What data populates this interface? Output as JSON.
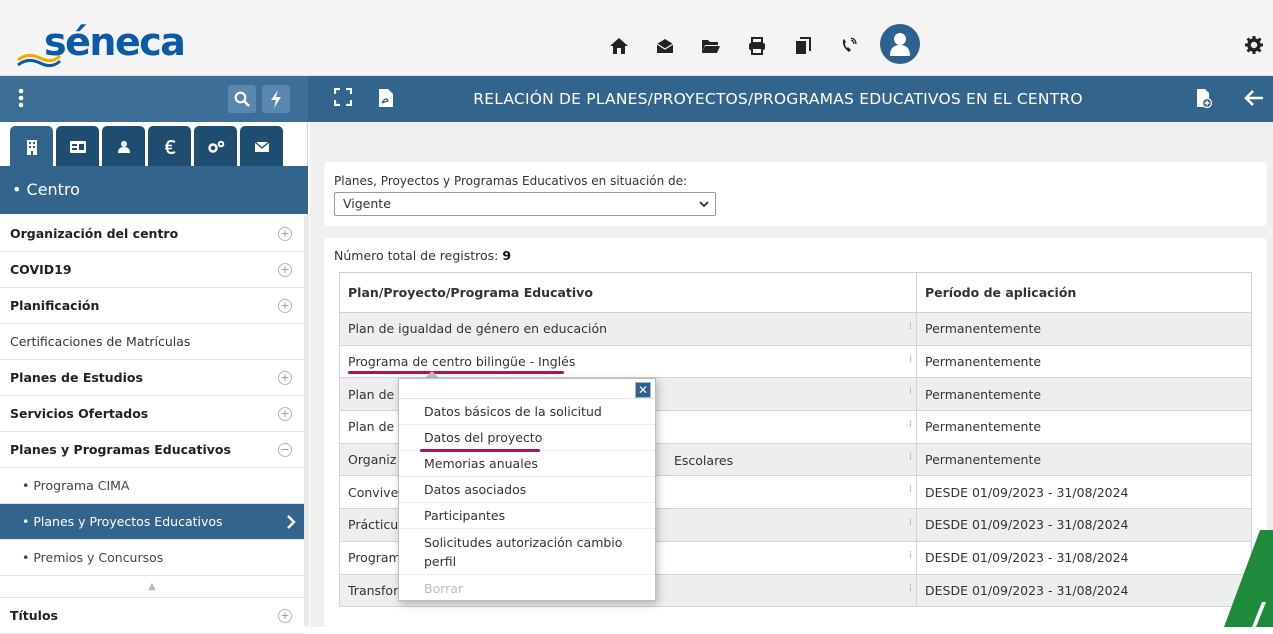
{
  "app": {
    "logo_text": "séneca"
  },
  "topbar": {
    "icons": [
      "home-icon",
      "inbox-icon",
      "folder-icon",
      "print-icon",
      "copy-icon",
      "phone-icon",
      "user-avatar-icon"
    ],
    "settings_icon": "gear-icon"
  },
  "titlebar": {
    "title": "RELACIÓN DE PLANES/PROYECTOS/PROGRAMAS EDUCATIVOS EN EL CENTRO"
  },
  "sidebar": {
    "tabs": [
      "building-icon",
      "id-card-icon",
      "people-icon",
      "euro-icon",
      "gears-icon",
      "mail-icon"
    ],
    "section_title": "• Centro",
    "items": [
      {
        "label": "Organización del centro",
        "expand": "+"
      },
      {
        "label": "COVID19",
        "expand": "+"
      },
      {
        "label": "Planificación",
        "expand": "+"
      },
      {
        "label": "Certificaciones de Matrículas"
      },
      {
        "label": "Planes de Estudios",
        "expand": "+"
      },
      {
        "label": "Servicios Ofertados",
        "expand": "+"
      },
      {
        "label": "Planes y Programas Educativos",
        "expand": "−"
      },
      {
        "label": "• Programa CIMA"
      },
      {
        "label": "• Planes y Proyectos Educativos"
      },
      {
        "label": "• Premios y Concursos"
      },
      {
        "label": "Títulos",
        "expand": "+"
      }
    ]
  },
  "filter": {
    "label": "Planes, Proyectos y Programas Educativos en situación de:",
    "selected": "Vigente"
  },
  "records": {
    "label": "Número total de registros:",
    "count": "9"
  },
  "table": {
    "headers": [
      "Plan/Proyecto/Programa Educativo",
      "Período de aplicación"
    ],
    "rows": [
      [
        "Plan de igualdad de género en educación",
        "Permanentemente"
      ],
      [
        "Programa de centro bilingüe - Inglés",
        "Permanentemente"
      ],
      [
        "Plan de",
        "Permanentemente"
      ],
      [
        "Plan de",
        "Permanentemente"
      ],
      [
        "Organiz",
        "Permanentemente"
      ],
      [
        "Convive",
        "DESDE 01/09/2023 - 31/08/2024"
      ],
      [
        "Prácticu",
        "DESDE 01/09/2023 - 31/08/2024"
      ],
      [
        "Program",
        "DESDE 01/09/2023 - 31/08/2024"
      ],
      [
        "Transfor",
        "DESDE 01/09/2023 - 31/08/2024"
      ]
    ],
    "row5_tail": "Escolares"
  },
  "context_menu": {
    "items": [
      "Datos básicos de la solicitud",
      "Datos del proyecto",
      "Memorias anuales",
      "Datos asociados",
      "Participantes",
      "Solicitudes autorización cambio perfil",
      "Borrar"
    ],
    "close_label": "✕"
  },
  "colors": {
    "brand_blue": "#0b5aa5",
    "header_blue": "#33648c",
    "highlight_red": "#b01453",
    "deco_green": "#1f8a3c"
  }
}
